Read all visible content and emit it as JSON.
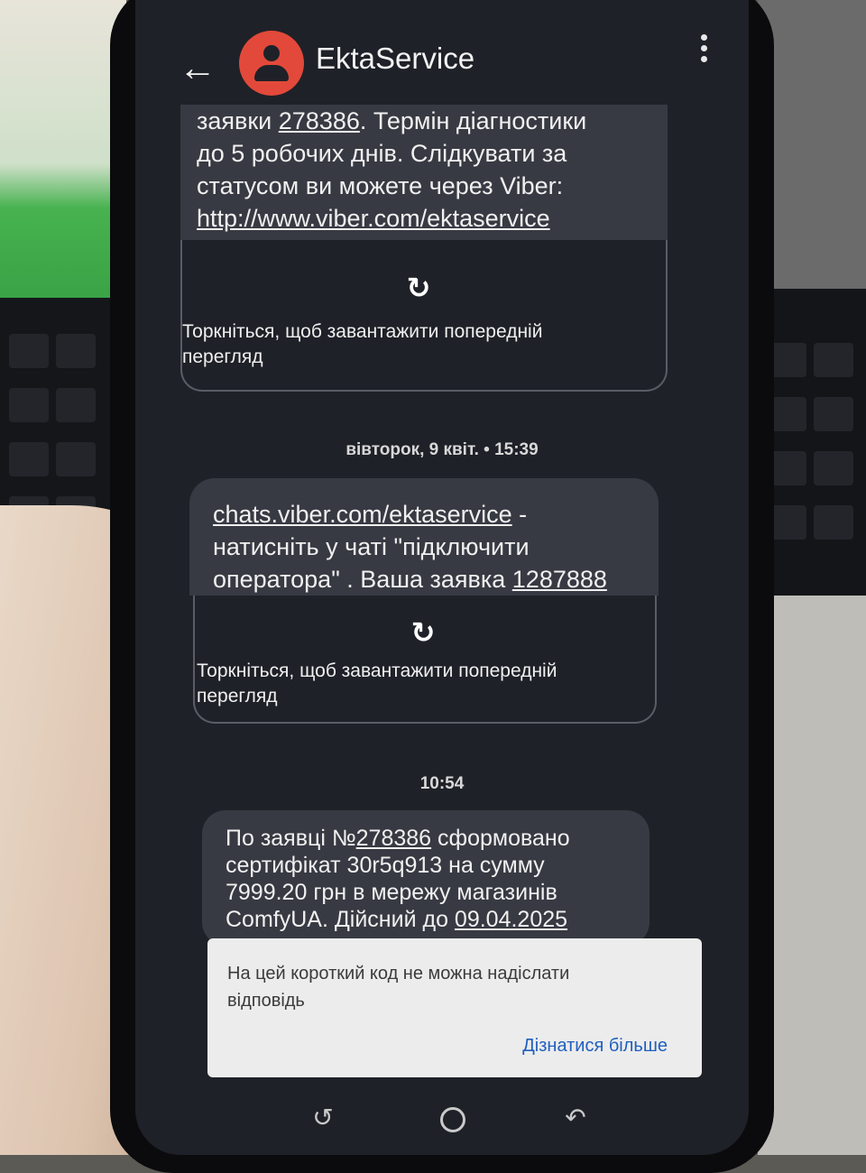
{
  "header": {
    "contact_name": "EktaService",
    "back_icon": "arrow-left-icon",
    "more_icon": "more-vertical-icon"
  },
  "messages": {
    "m1": {
      "line1_prefix": "заявки ",
      "line1_link": "278386",
      "line1_suffix": ". Термін діагностики",
      "line2": "до 5 робочих  днів. Слідкувати за",
      "line3": "статусом ви можете через Viber:",
      "link": "http://www.viber.com/ektaservice",
      "preview_label": "Торкніться, щоб завантажити попередній перегляд"
    },
    "timestamp1": "вівторок, 9 квіт. • 15:39",
    "m2": {
      "link": "chats.viber.com/ektaservice",
      "line1_suffix": " -",
      "line2": "натисніть у чаті \"підключити",
      "line3_prefix": "оператора\" . Ваша заявка ",
      "line3_link": "1287888",
      "preview_label": "Торкніться, щоб завантажити попередній перегляд"
    },
    "timestamp2": "10:54",
    "m3": {
      "line1_prefix": "По заявці №",
      "line1_link": "278386",
      "line1_suffix": " сформовано",
      "line2": "сертифікат 30r5q913 на сумму",
      "line3": "7999.20 грн в мережу магазинів",
      "line4_prefix": "ComfyUA. Дійсний до ",
      "line4_link": "09.04.2025"
    }
  },
  "info_sheet": {
    "text": "На цей короткий код не можна надіслати відповідь",
    "link_label": "Дізнатися більше"
  },
  "colors": {
    "avatar": "#e2493b",
    "bubble": "#383a43",
    "screen_bg": "#1f2128",
    "link": "#1f5fbf"
  }
}
